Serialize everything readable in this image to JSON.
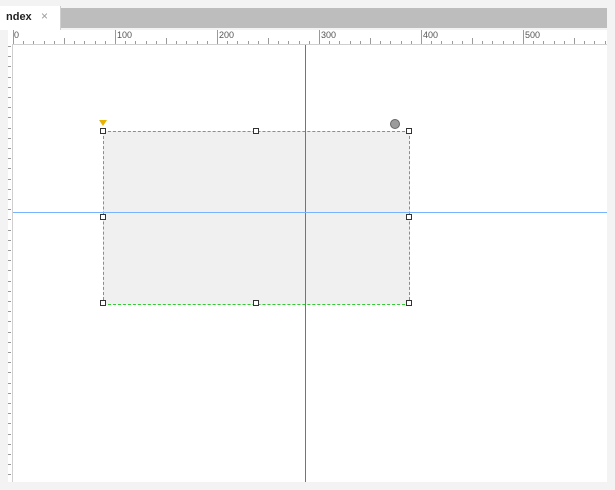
{
  "tab": {
    "label": "ndex",
    "close_glyph": "×"
  },
  "ruler": {
    "labels": [
      "0",
      "100",
      "200",
      "300",
      "400",
      "500"
    ]
  },
  "colors": {
    "selection_border": "#33cc33",
    "vertical_guide": "#d233d2",
    "horizontal_guide": "#79b3ff",
    "shape_fill": "#f0f0f0"
  }
}
